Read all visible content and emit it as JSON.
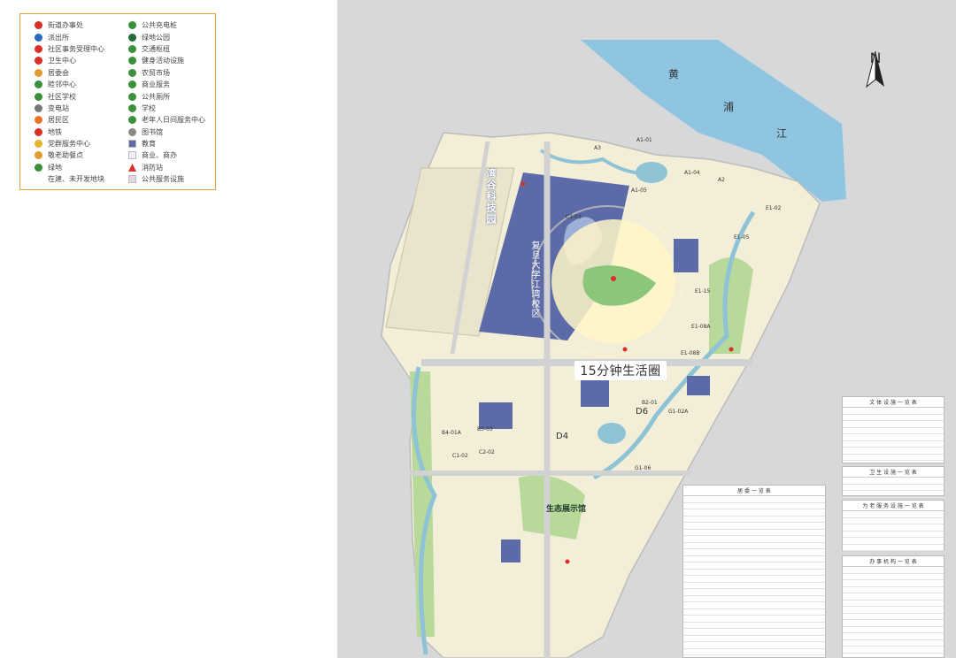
{
  "legend": {
    "col1": [
      {
        "label": "街道办事处",
        "icon": "star-circle-icon",
        "color": "#d9302a"
      },
      {
        "label": "派出所",
        "icon": "shield-icon",
        "color": "#2a6cc4"
      },
      {
        "label": "社区事务受理中心",
        "icon": "handshake-circle-icon",
        "color": "#d9302a"
      },
      {
        "label": "卫生中心",
        "icon": "medical-cross-icon",
        "color": "#d9302a"
      },
      {
        "label": "居委会",
        "icon": "house-badge-icon",
        "color": "#e39b2f"
      },
      {
        "label": "睦邻中心",
        "icon": "neighbors-icon",
        "color": "#3a8f3a"
      },
      {
        "label": "社区学校",
        "icon": "book-icon",
        "color": "#3a8f3a"
      },
      {
        "label": "变电站",
        "icon": "bolt-icon",
        "color": "#777777"
      },
      {
        "label": "居民区",
        "icon": "residence-icon",
        "color": "#e7742a"
      },
      {
        "label": "地铁",
        "icon": "metro-icon",
        "color": "#d9302a"
      },
      {
        "label": "党群服务中心",
        "icon": "party-icon",
        "color": "#e4b52a"
      },
      {
        "label": "敬老助餐点",
        "icon": "elderly-meal-icon",
        "color": "#e39b2f"
      },
      {
        "label": "绿地",
        "icon": "greenspace-icon",
        "color": "#3a8f3a"
      },
      {
        "label": "在建、未开发地块",
        "icon": "",
        "color": ""
      }
    ],
    "col2": [
      {
        "label": "公共充电桩",
        "icon": "charger-icon",
        "color": "#3a8f3a"
      },
      {
        "label": "绿地公园",
        "icon": "tree-icon",
        "color": "#1f6b3a"
      },
      {
        "label": "交通枢纽",
        "icon": "bus-icon",
        "color": "#3a8f3a"
      },
      {
        "label": "健身活动设施",
        "icon": "runner-icon",
        "color": "#3a8f3a"
      },
      {
        "label": "农贸市场",
        "icon": "market-icon",
        "color": "#3a8f3a"
      },
      {
        "label": "商业服务",
        "icon": "shopping-icon",
        "color": "#3a8f3a"
      },
      {
        "label": "公共厕所",
        "icon": "toilet-icon",
        "color": "#3a8f3a"
      },
      {
        "label": "学校",
        "icon": "school-icon",
        "color": "#3a8f3a"
      },
      {
        "label": "老年人日间服务中心",
        "icon": "elderly-day-icon",
        "color": "#3a8f3a"
      },
      {
        "label": "图书馆",
        "icon": "library-icon",
        "color": "#888888"
      },
      {
        "label": "教育",
        "icon": "swatch-education",
        "color": "#5c6aa8"
      },
      {
        "label": "商业、商办",
        "icon": "swatch-commercial",
        "color": "#eef0f7"
      },
      {
        "label": "消防站",
        "icon": "triangle-icon",
        "color": "#d9302a"
      },
      {
        "label": "公共服务设施",
        "icon": "swatch-public",
        "color": "#e4d6e4"
      }
    ]
  },
  "map": {
    "overlay_label": "15分钟生活圈",
    "compass_label": "N",
    "river": [
      "黄",
      "浦",
      "江"
    ],
    "campus_label": "复旦大学江湾校区",
    "tech_park_label": "湾谷科技园",
    "exhibition_label": "生态展示馆",
    "block_labels": [
      "A1-01",
      "A3",
      "A2",
      "A1-04",
      "A1-05",
      "C1-03",
      "E1-02",
      "E1-05",
      "E1-15",
      "E1-08A",
      "E1-08B",
      "B2-01",
      "D6",
      "G1-02A",
      "G1-06",
      "B4-01A",
      "B5-03",
      "C1-02",
      "C2-02",
      "D4"
    ],
    "colors": {
      "river": "#8fc5e0",
      "land": "#f3eed8",
      "education": "#5c6aa8",
      "green": "#b8d99a",
      "canal": "#8ec3d6",
      "highlight": "#fff6c8"
    }
  },
  "tables": [
    {
      "title": "文 体 设 施 一 览 表"
    },
    {
      "title": "卫 生 设 施 一 览 表"
    },
    {
      "title": "为 老 服 务 设 施 一 览 表"
    },
    {
      "title": "办 事 机 构 一 览 表"
    },
    {
      "title": "居 委 一 览 表"
    }
  ]
}
